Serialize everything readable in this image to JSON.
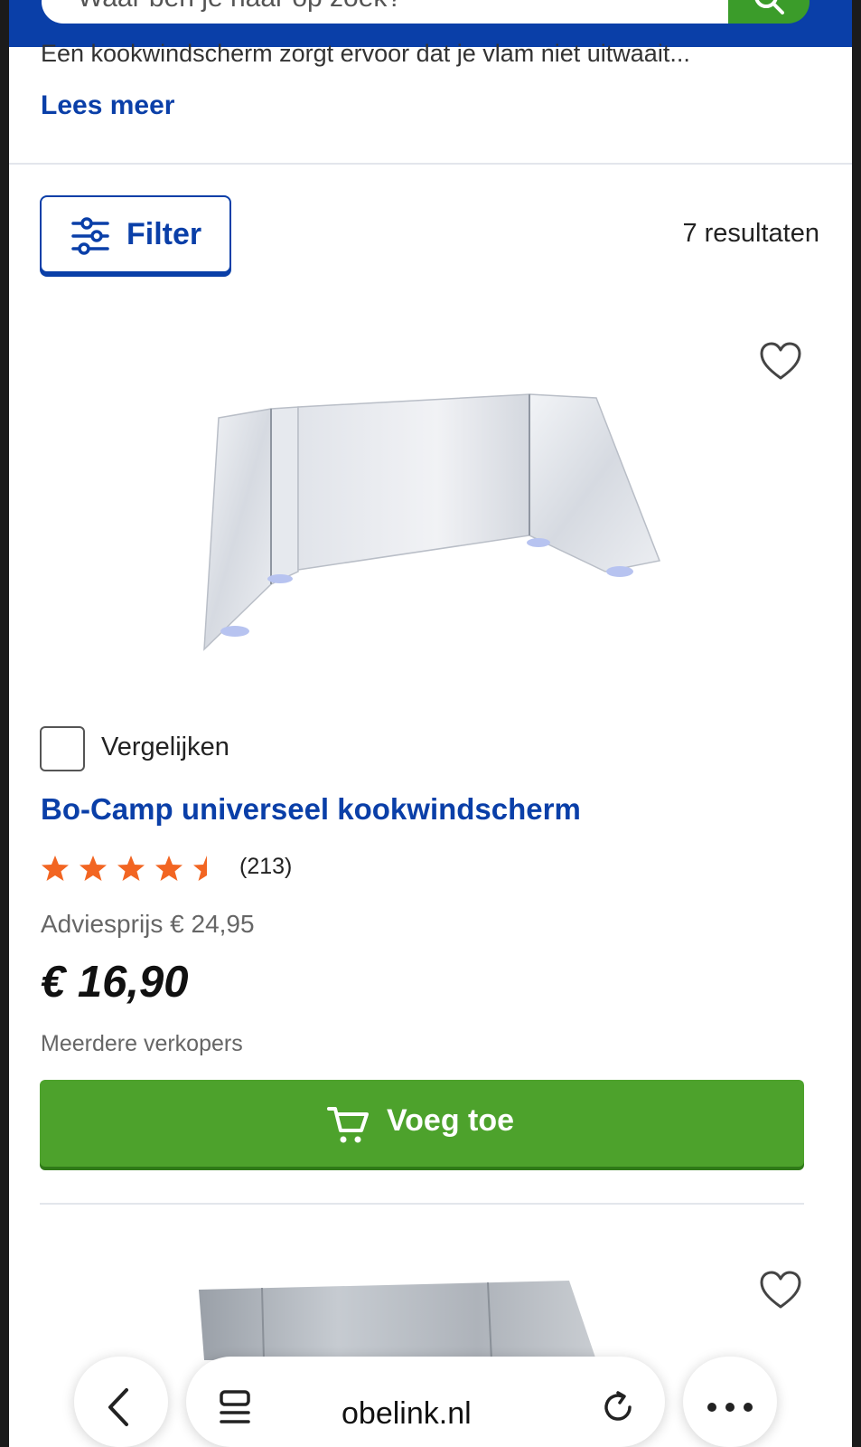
{
  "search": {
    "placeholder": "Waar ben je naar op zoek?"
  },
  "category": {
    "description": "Een kookwindscherm zorgt ervoor dat je vlam niet uitwaait...",
    "read_more": "Lees meer"
  },
  "toolbar": {
    "filter_label": "Filter",
    "result_count": "7 resultaten"
  },
  "products": [
    {
      "compare_label": "Vergelijken",
      "title": "Bo-Camp universeel kookwindscherm",
      "rating": 4.5,
      "rating_max": 5,
      "review_count": "(213)",
      "advice_price": "Adviesprijs € 24,95",
      "price": "€ 16,90",
      "sellers": "Meerdere verkopers",
      "add_label": "Voeg toe"
    }
  ],
  "browser": {
    "url": "obelink.nl"
  },
  "colors": {
    "brand_blue": "#0a3fa8",
    "add_green": "#4da22c",
    "star_orange": "#f26522"
  }
}
